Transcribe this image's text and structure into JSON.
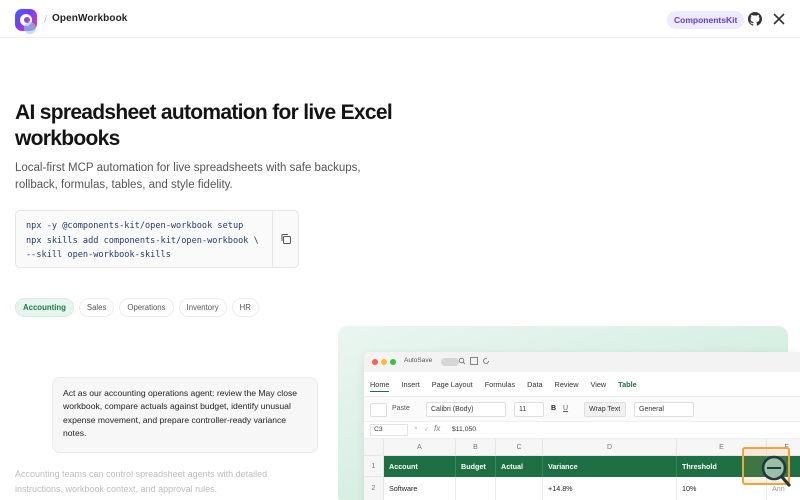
{
  "header": {
    "brand": "OpenWorkbook",
    "separator": "/",
    "kit_badge": "ComponentsKit"
  },
  "hero": {
    "title": "AI spreadsheet automation for live Excel workbooks",
    "subtitle": "Local-first MCP automation for live spreadsheets with safe backups, rollback, formulas, tables, and style fidelity."
  },
  "install": {
    "lines": [
      "npx -y @components-kit/open-workbook setup",
      "npx skills add components-kit/open-workbook \\",
      "--skill open-workbook-skills"
    ]
  },
  "tabs": [
    "Accounting",
    "Sales",
    "Operations",
    "Inventory",
    "HR"
  ],
  "active_tab": "Accounting",
  "prompt": "Act as our accounting operations agent: review the May close workbook, compare actuals against budget, identify unusual expense movement, and prepare controller-ready variance notes.",
  "note": "Accounting teams can control spreadsheet agents with detailed instructions, workbook context, and approval rules.",
  "excel": {
    "autosave_label": "AutoSave",
    "ribbon_tabs": [
      "Home",
      "Insert",
      "Page Layout",
      "Formulas",
      "Data",
      "Review",
      "View",
      "Table"
    ],
    "paste_label": "Paste",
    "font": "Calibri (Body)",
    "font_size": "11",
    "bold": "B",
    "underline": "U",
    "wrap_text": "Wrap Text",
    "number_format": "General",
    "cell_ref": "C3",
    "formula_x": "×",
    "formula_check": "✓",
    "fx": "fx",
    "formula_value": "$11,050",
    "columns": [
      "A",
      "B",
      "C",
      "D",
      "E",
      "F"
    ],
    "rows": [
      "1",
      "2"
    ],
    "headers": [
      "Account",
      "Budget",
      "Actual",
      "Variance",
      "Threshold",
      ""
    ],
    "row2": [
      "Software",
      "",
      "",
      "+14.8%",
      "10%",
      "Ann"
    ]
  },
  "colors": {
    "accent_green": "#1f6f45",
    "badge_purple": "#5b3fd6",
    "tab_active_bg": "#e6f6ee"
  }
}
